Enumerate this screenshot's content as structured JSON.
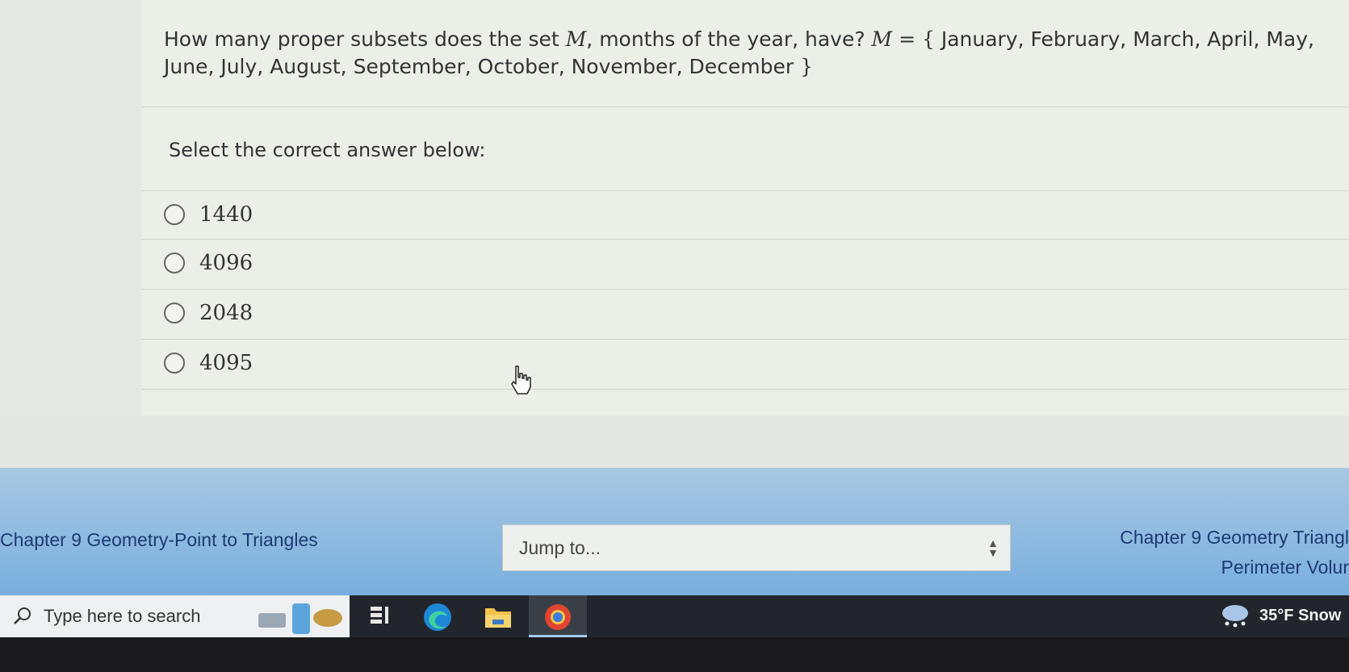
{
  "question": {
    "intro": "How many proper subsets does the set ",
    "set_symbol": "M",
    "mid": ", months of the year, have? ",
    "equals": " = ",
    "open_brace": "{",
    "months": " January, February, March, April, May, June, July, August, September, October, November, December ",
    "close_brace": "}"
  },
  "prompt": "Select the correct answer below:",
  "options": [
    {
      "label": "1440"
    },
    {
      "label": "4096"
    },
    {
      "label": "2048"
    },
    {
      "label": "4095"
    }
  ],
  "navigation": {
    "previous": "Chapter 9 Geometry-Point to Triangles",
    "jump_placeholder": "Jump to...",
    "next_line1": "Chapter 9 Geometry Triangl",
    "next_line2": "Perimeter Volur"
  },
  "taskbar": {
    "search_placeholder": "Type here to search",
    "weather": "35°F  Snow"
  },
  "colors": {
    "link": "#1d3b73",
    "band": "#8bbbe0",
    "taskbar": "#22262c"
  }
}
